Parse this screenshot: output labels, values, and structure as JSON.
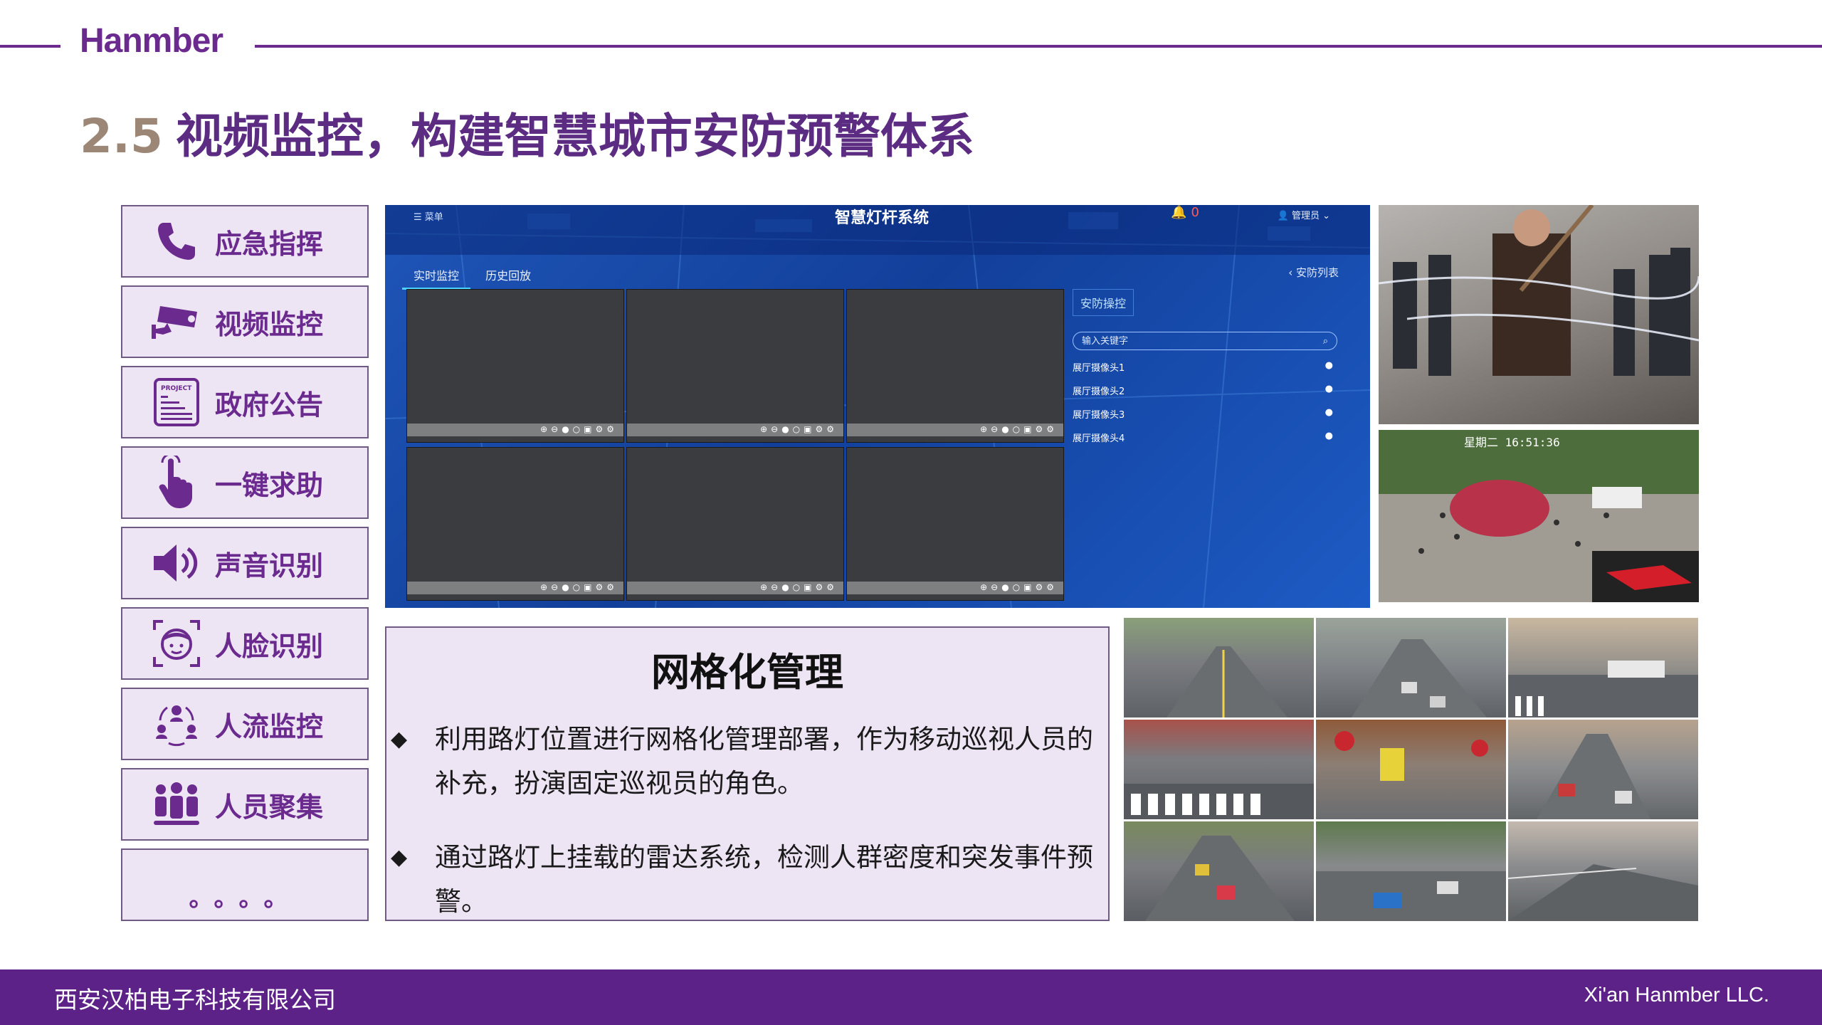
{
  "header": {
    "brand": "Hanmber",
    "title_number": "2.5",
    "title_text": "视频监控，构建智慧城市安防预警体系"
  },
  "menu": {
    "items": [
      {
        "label": "应急指挥",
        "icon": "phone-icon"
      },
      {
        "label": "视频监控",
        "icon": "cctv-camera-icon"
      },
      {
        "label": "政府公告",
        "icon": "project-document-icon"
      },
      {
        "label": "一键求助",
        "icon": "hand-pointer-icon"
      },
      {
        "label": "声音识别",
        "icon": "speaker-icon"
      },
      {
        "label": "人脸识别",
        "icon": "face-scan-icon"
      },
      {
        "label": "人流监控",
        "icon": "people-flow-icon"
      },
      {
        "label": "人员聚集",
        "icon": "crowd-icon"
      }
    ],
    "more": "。。。。"
  },
  "dashboard": {
    "menu": "菜单",
    "title": "智慧灯杆系统",
    "alarm_count": "0",
    "user": "管理员",
    "tabs": [
      "实时监控",
      "历史回放"
    ],
    "back_link": "安防列表",
    "panel_title": "安防操控",
    "search_placeholder": "输入关键字",
    "cameras": [
      "展厅摄像头1",
      "展厅摄像头2",
      "展厅摄像头3",
      "展厅摄像头4"
    ]
  },
  "photo_timestamp": "星期二 16:51:36",
  "management": {
    "title": "网格化管理",
    "bullets": [
      "利用路灯位置进行网格化管理部署，作为移动巡视人员的补充，扮演固定巡视员的角色。",
      "通过路灯上挂载的雷达系统，检测人群密度和突发事件预警。"
    ]
  },
  "footer": {
    "company_cn": "西安汉柏电子科技有限公司",
    "company_en": "Xi'an Hanmber LLC."
  },
  "colors": {
    "brand_purple": "#6b2a8e",
    "title_purple": "#5b2c82",
    "title_number": "#9c8777",
    "box_fill": "#ede4f4",
    "footer": "#5c2287"
  }
}
